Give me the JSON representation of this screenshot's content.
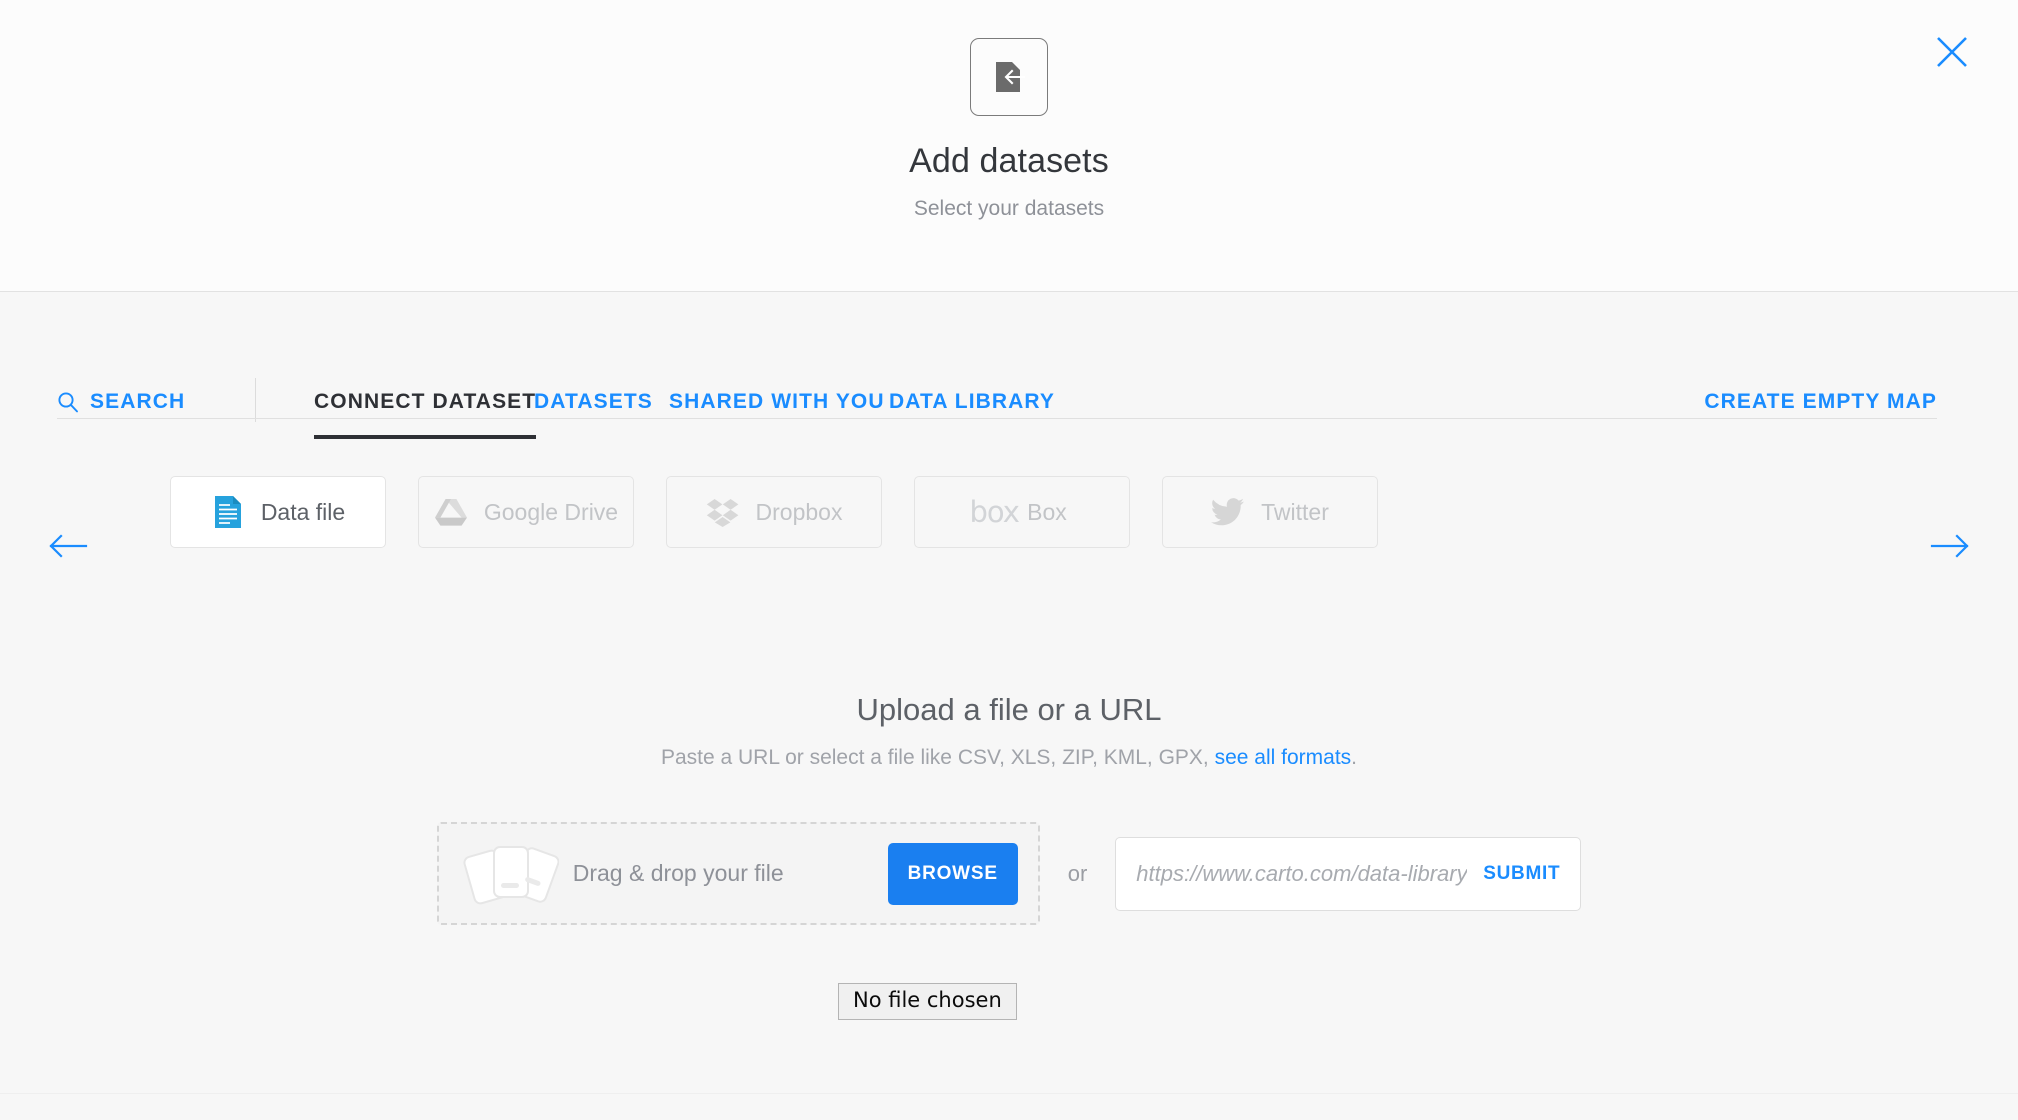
{
  "header": {
    "icon": "import-file-icon",
    "title": "Add datasets",
    "subtitle": "Select your datasets",
    "close_icon": "close-icon",
    "accent_color": "#1a8cff"
  },
  "tabs": {
    "search": {
      "label": "SEARCH",
      "icon": "search-icon",
      "active": false
    },
    "items": [
      {
        "label": "CONNECT DATASET",
        "active": true
      },
      {
        "label": "DATASETS",
        "active": false
      },
      {
        "label": "SHARED WITH YOU",
        "active": false
      },
      {
        "label": "DATA LIBRARY",
        "active": false
      }
    ],
    "create_empty_map": "CREATE EMPTY MAP"
  },
  "connectors": {
    "prev_arrow_icon": "arrow-left-icon",
    "next_arrow_icon": "arrow-right-icon",
    "items": [
      {
        "label": "Data file",
        "icon": "data-file-icon",
        "selected": true
      },
      {
        "label": "Google Drive",
        "icon": "google-drive-icon",
        "selected": false
      },
      {
        "label": "Dropbox",
        "icon": "dropbox-icon",
        "selected": false
      },
      {
        "label": "Box",
        "icon": "box-icon",
        "selected": false
      },
      {
        "label": "Twitter",
        "icon": "twitter-icon",
        "selected": false
      }
    ]
  },
  "upload": {
    "title": "Upload a file or a URL",
    "subtitle_prefix": "Paste a URL or select a file like CSV, XLS, ZIP, KML, GPX, ",
    "subtitle_link": "see all formats",
    "subtitle_suffix": ".",
    "dropzone_text": "Drag & drop your file",
    "dropzone_icon": "files-stack-icon",
    "browse_label": "BROWSE",
    "or_label": "or",
    "url_placeholder": "https://www.carto.com/data-library",
    "url_value": "",
    "submit_label": "SUBMIT"
  },
  "file_tooltip": {
    "text": "No file chosen"
  }
}
